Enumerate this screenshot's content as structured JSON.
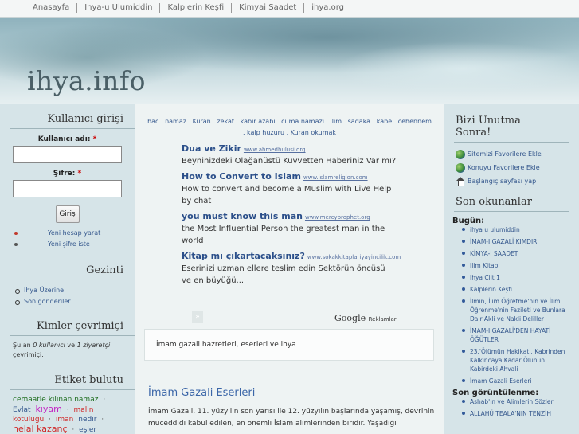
{
  "topnav": [
    "Anasayfa",
    "Ihya-u Ulumiddin",
    "Kalplerin Keşfi",
    "Kimyai Saadet",
    "ihya.org"
  ],
  "site": {
    "title": "ihya.info"
  },
  "login": {
    "title": "Kullanıcı girişi",
    "username_label": "Kullanıcı adı:",
    "password_label": "Şifre:",
    "required_mark": "*",
    "button": "Giriş",
    "links": [
      "Yeni hesap yarat",
      "Yeni şifre iste"
    ],
    "link_dot_colors": [
      "#c0392b",
      "#555555"
    ]
  },
  "gezinti": {
    "title": "Gezinti",
    "items": [
      "Ihya Üzerine",
      "Son gönderiler"
    ]
  },
  "online": {
    "title": "Kimler çevrimiçi",
    "text_pre": "Şu an ",
    "users": "0 kullanıcı",
    "text_mid": " ve ",
    "guests": "1 ziyaretçi",
    "text_post": " çevrimiçi."
  },
  "tags": {
    "title": "Etiket bulutu",
    "items": [
      {
        "text": "cemaatle kılınan namaz",
        "color": "#1f6e1f"
      },
      {
        "text": "·",
        "color": "#555555"
      },
      {
        "text": "Evlat",
        "color": "#33568c"
      },
      {
        "text": "kıyam",
        "color": "#c21fc2"
      },
      {
        "text": "·",
        "color": "#555555"
      },
      {
        "text": "malın kötülüğü",
        "color": "#d02a2a"
      },
      {
        "text": "·",
        "color": "#555555"
      },
      {
        "text": "iman",
        "color": "#d02a2a"
      },
      {
        "text": "nedir",
        "color": "#33568c"
      },
      {
        "text": "·",
        "color": "#555555"
      },
      {
        "text": "helal kazanç",
        "color": "#d02a2a"
      },
      {
        "text": "·",
        "color": "#555555"
      },
      {
        "text": "eşler",
        "color": "#33568c"
      }
    ]
  },
  "center": {
    "tags_line": "hac . namaz . Kuran . zekat . kabir azabı . cuma namazı . ilim . sadaka . kabe . cehennem . kalp huzuru . Kuran okumak",
    "ads": [
      {
        "title": "Dua ve Zikir",
        "url": "www.ahmedhulusi.org",
        "desc": "Beyninizdeki Olağanüstü Kuvvetten Haberiniz Var mı?"
      },
      {
        "title": "How to Convert to Islam",
        "url": "www.islamreligion.com",
        "desc": "How to convert and become a Muslim with Live Help by chat"
      },
      {
        "title": "you must know this man",
        "url": "www.mercyprophet.org",
        "desc": "the Most Influential Person the greatest man in the world"
      },
      {
        "title": "Kitap mı çıkartacaksınız?",
        "url": "www.sokakkitaplariyayincilik.com",
        "desc": "Eserinizi uzman ellere teslim edin Sektörün öncüsü ve en büyüğü..."
      }
    ],
    "ad_next": "»",
    "google": "Google",
    "google_suffix": "Reklamları",
    "intro": "İmam gazali hazretleri, eserleri ve ihya",
    "article_title": "İmam Gazali Eserleri",
    "article_text": "İmam Gazali, 11. yüzyılın son yarısı ile 12. yüzyılın başlarında yaşamış, devrinin müceddidi kabul edilen, en önemli İslam alimlerinden biridir. Yaşadığı"
  },
  "right": {
    "bookmark_title": "Bizi Unutma Sonra!",
    "bookmarks": [
      {
        "icon": "globe-icon",
        "label": "Sitemizi Favorilere Ekle"
      },
      {
        "icon": "globe-icon",
        "label": "Konuyu Favorilere Ekle"
      },
      {
        "icon": "home-icon",
        "label": "Başlangıç sayfası yap"
      }
    ],
    "recent_title": "Son okunanlar",
    "today_label": "Bugün:",
    "today": [
      "ihya u ulumiddin",
      "İMAM-I GAZALİ KIMDIR",
      "KİMYA-İ SAADET",
      "Ilim Kitabi",
      "Ihya Cilt 1",
      "Kalplerin Keşfi",
      "İlmin, İlim Öğretme'nin ve İlim Öğrenme'nin Fazileti ve Bunlara Dair Akli ve Nakli Deliller",
      "İMAM-I GAZALİ'DEN HAYATİ ÖĞÜTLER",
      "23.'Ölümün Hakikati, Kabrinden Kalkıncaya Kadar Ölünün Kabirdeki Ahvali",
      "İmam Gazali Eserleri"
    ],
    "views_label": "Son görüntülenme:",
    "views": [
      "Ashab'ın ve Alimlerin Sözleri",
      "ALLAHÜ TEALA'NIN TENZİH"
    ]
  }
}
